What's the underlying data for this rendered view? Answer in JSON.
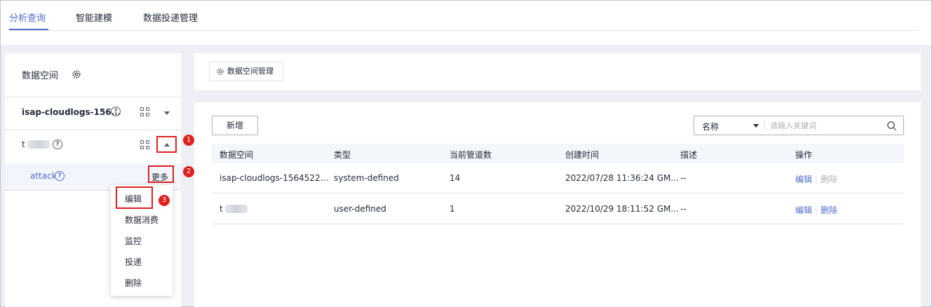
{
  "tabs": [
    "分析查询",
    "智能建模",
    "数据投递管理"
  ],
  "sidebar": {
    "title": "数据空间",
    "workspaces": [
      {
        "name": "isap-cloudlogs-156...",
        "help": "?"
      },
      {
        "name": "t"
      }
    ],
    "pipeline": {
      "name": "attack",
      "help": "?",
      "more": "更多"
    },
    "menu": [
      "编辑",
      "数据消费",
      "监控",
      "投递",
      "删除"
    ],
    "markers": [
      "1",
      "2",
      "3"
    ]
  },
  "top_panel": {
    "manage_button": "数据空间管理"
  },
  "main": {
    "new_button": "新增",
    "search": {
      "field": "名称",
      "placeholder": "请输入关键词"
    },
    "columns": [
      "数据空间",
      "类型",
      "当前管道数",
      "创建时间",
      "描述",
      "操作"
    ],
    "rows": [
      {
        "name": "isap-cloudlogs-1564522...",
        "type": "system-defined",
        "pipes": "14",
        "created": "2022/07/28 11:36:24 GM...",
        "desc": "--",
        "edit": "编辑",
        "delete": "删除"
      },
      {
        "name": "t",
        "type": "user-defined",
        "pipes": "1",
        "created": "2022/10/29 18:11:52 GM...",
        "desc": "--",
        "edit": "编辑",
        "delete": "删除"
      }
    ]
  },
  "colors": {
    "accent": "#526ecc",
    "marker": "#e02020"
  }
}
